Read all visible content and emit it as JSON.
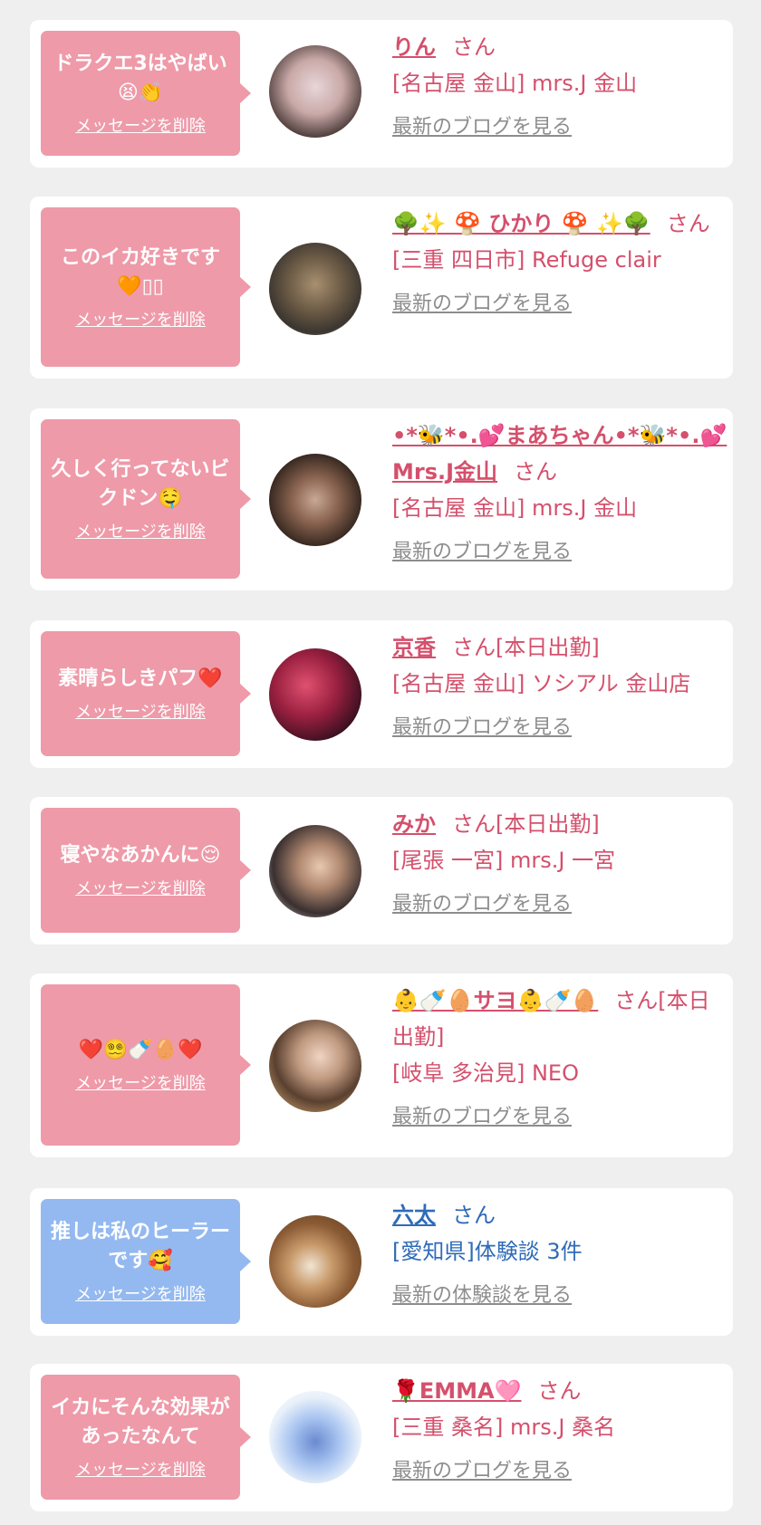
{
  "common": {
    "delete_label": "メッセージを削除",
    "san": "さん"
  },
  "items": [
    {
      "message": "ドラクエ3はやばい😫👏",
      "name": "りん",
      "suffix": "さん",
      "shop": "[名古屋 金山] mrs.J 金山",
      "blog": "最新のブログを見る",
      "theme": "pink"
    },
    {
      "message": "このイカ好きです🧡▯▯",
      "name": "🌳✨ 🍄 ひかり 🍄 ✨🌳",
      "suffix": "さん",
      "shop": "[三重 四日市] Refuge clair",
      "blog": "最新のブログを見る",
      "theme": "pink"
    },
    {
      "message": "久しく行ってないビクドン🤤",
      "name": "•*🐝*•.💕まあちゃん•*🐝*•.💕Mrs.J金山",
      "suffix": "さん",
      "shop": "[名古屋 金山] mrs.J 金山",
      "blog": "最新のブログを見る",
      "theme": "pink"
    },
    {
      "message": "素晴らしきパフ❤️",
      "name": "京香",
      "suffix": "さん[本日出勤]",
      "shop": "[名古屋 金山] ソシアル 金山店",
      "blog": "最新のブログを見る",
      "theme": "pink"
    },
    {
      "message": "寝やなあかんに😌",
      "name": "みか",
      "suffix": "さん[本日出勤]",
      "shop": "[尾張 一宮] mrs.J 一宮",
      "blog": "最新のブログを見る",
      "theme": "pink"
    },
    {
      "message": "❤️😵‍💫🍼🥚❤️",
      "name": "👶🍼🥚サヨ👶🍼🥚",
      "suffix": "さん[本日出勤]",
      "shop": "[岐阜 多治見] NEO",
      "blog": "最新のブログを見る",
      "theme": "pink"
    },
    {
      "message": "推しは私のヒーラーです🥰",
      "name": "六太",
      "suffix": "さん",
      "shop": "[愛知県]体験談 3件",
      "blog": "最新の体験談を見る",
      "theme": "blue"
    },
    {
      "message": "イカにそんな効果があったなんて",
      "name": "🌹EMMA🩷",
      "suffix": "さん",
      "shop": "[三重 桑名] mrs.J 桑名",
      "blog": "最新のブログを見る",
      "theme": "pink"
    }
  ],
  "colors": {
    "pink_bubble": "#ee9aa9",
    "blue_bubble": "#94b9f0",
    "pink_text": "#d4506c",
    "blue_text": "#2f6bb8",
    "link_gray": "#8d8d8d",
    "background": "#efefef"
  }
}
